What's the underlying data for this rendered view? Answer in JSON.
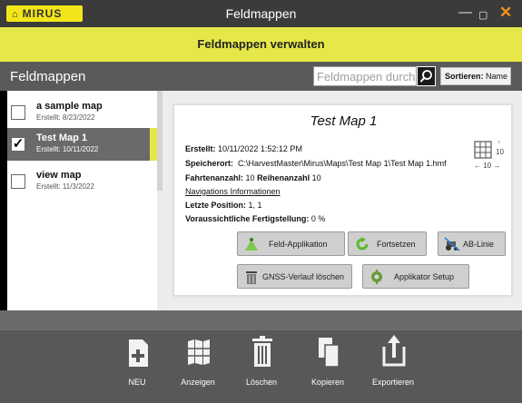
{
  "app": {
    "logo_text": "MIRUS",
    "window_title": "Feldmappen",
    "subtitle": "Feldmappen verwalten"
  },
  "toolbar": {
    "title": "Feldmappen",
    "search_placeholder": "Feldmappen durchsuchen",
    "sort_label": "Sortieren:",
    "sort_value": "Name"
  },
  "maps": [
    {
      "name": "a sample map",
      "created": "Erstellt: 8/23/2022",
      "checked": false
    },
    {
      "name": "Test Map 1",
      "created": "Erstellt: 10/11/2022",
      "checked": true
    },
    {
      "name": "view map",
      "created": "Erstellt: 11/3/2022",
      "checked": false
    }
  ],
  "detail": {
    "title": "Test Map 1",
    "created_label": "Erstellt:",
    "created_value": "10/11/2022 1:52:12 PM",
    "location_label": "Speicherort:",
    "location_value": "C:\\HarvestMaster\\Mirus\\Maps\\Test Map 1\\Test Map 1.hmf",
    "drive_count_label": "Fahrtenanzahl:",
    "drive_count_value": "10",
    "row_count_label": "Reihenanzahl",
    "row_count_value": "10",
    "nav_link": "Navigations Informationen",
    "last_pos_label": "Letzte Position:",
    "last_pos_value": "1, 1",
    "completion_label": "Voraussichtliche Fertigstellung:",
    "completion_value": "0 %",
    "grid_rows": "10",
    "grid_cols": "← 10 →",
    "grid_arrow": "↑"
  },
  "actions": {
    "field_app": "Feld-Applikation",
    "continue": "Fortsetzen",
    "ab_line": "AB-Linie",
    "gnss_delete": "GNSS-Verlauf löschen",
    "applicator_setup": "Applikator Setup"
  },
  "bottom": {
    "new": "NEU",
    "view": "Anzeigen",
    "delete": "Löschen",
    "copy": "Kopieren",
    "export": "Exportieren"
  },
  "colors": {
    "accent_yellow": "#e6e84a",
    "window_close": "#f7941d",
    "continue_green": "#5cb82e"
  }
}
